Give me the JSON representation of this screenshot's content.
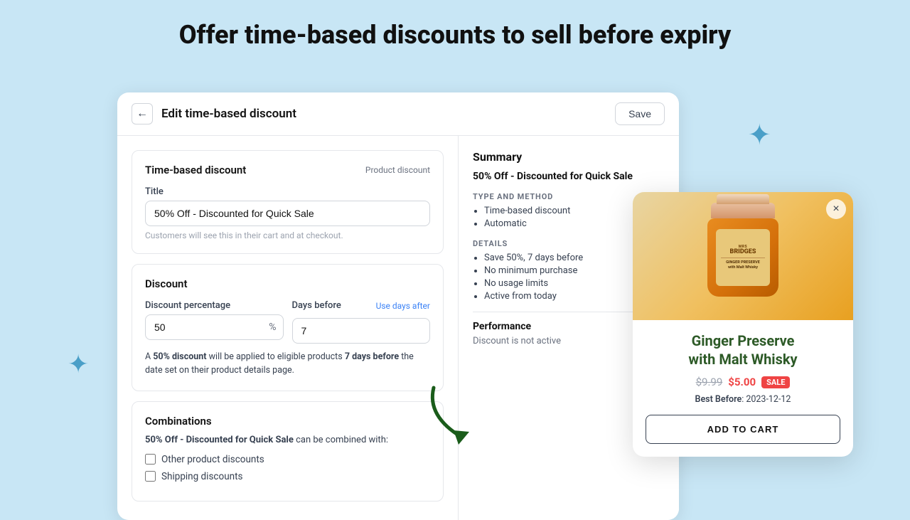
{
  "page": {
    "heading": "Offer time-based discounts to sell before expiry"
  },
  "topbar": {
    "title": "Edit time-based discount",
    "save_label": "Save",
    "back_label": "←"
  },
  "left": {
    "time_based_card": {
      "title": "Time-based discount",
      "badge": "Product discount"
    },
    "title_field": {
      "label": "Title",
      "value": "50% Off - Discounted for Quick Sale",
      "hint": "Customers will see this in their cart and at checkout."
    },
    "discount_card": {
      "title": "Discount",
      "percentage_label": "Discount percentage",
      "percentage_value": "50",
      "percentage_suffix": "%",
      "days_label": "Days before",
      "days_link": "Use days after",
      "days_value": "7",
      "description_parts": {
        "prefix": "A ",
        "bold1": "50% discount",
        "middle": " will be applied to eligible products ",
        "bold2": "7 days before",
        "suffix": " the date set on their product details page."
      }
    },
    "combinations_card": {
      "title": "Combinations",
      "combo_text_prefix": "50% Off - Discounted for Quick Sale",
      "combo_text_suffix": " can be combined with:",
      "checkboxes": [
        {
          "label": "Other product discounts",
          "checked": false
        },
        {
          "label": "Shipping discounts",
          "checked": false
        }
      ]
    }
  },
  "right": {
    "summary": {
      "title": "Summary",
      "name": "50% Off - Discounted for Quick Sale",
      "type_method": {
        "section_label": "TYPE AND METHOD",
        "items": [
          "Time-based discount",
          "Automatic"
        ]
      },
      "details": {
        "section_label": "DETAILS",
        "items": [
          "Save 50%, 7 days before",
          "No minimum purchase",
          "No usage limits",
          "Active from today"
        ]
      }
    },
    "performance": {
      "title": "Performance",
      "status": "Discount is not active"
    }
  },
  "product_popup": {
    "name": "Ginger Preserve\nwith Malt Whisky",
    "price_original": "$9.99",
    "price_sale": "$5.00",
    "sale_badge": "SALE",
    "best_before_label": "Best Before",
    "best_before_value": "2023-12-12",
    "add_to_cart_label": "ADD TO CART",
    "close_label": "×",
    "jar_brand": "MRS BRIDGES",
    "jar_product": "GINGER PRESERVE\nwith Malt Whisky"
  }
}
